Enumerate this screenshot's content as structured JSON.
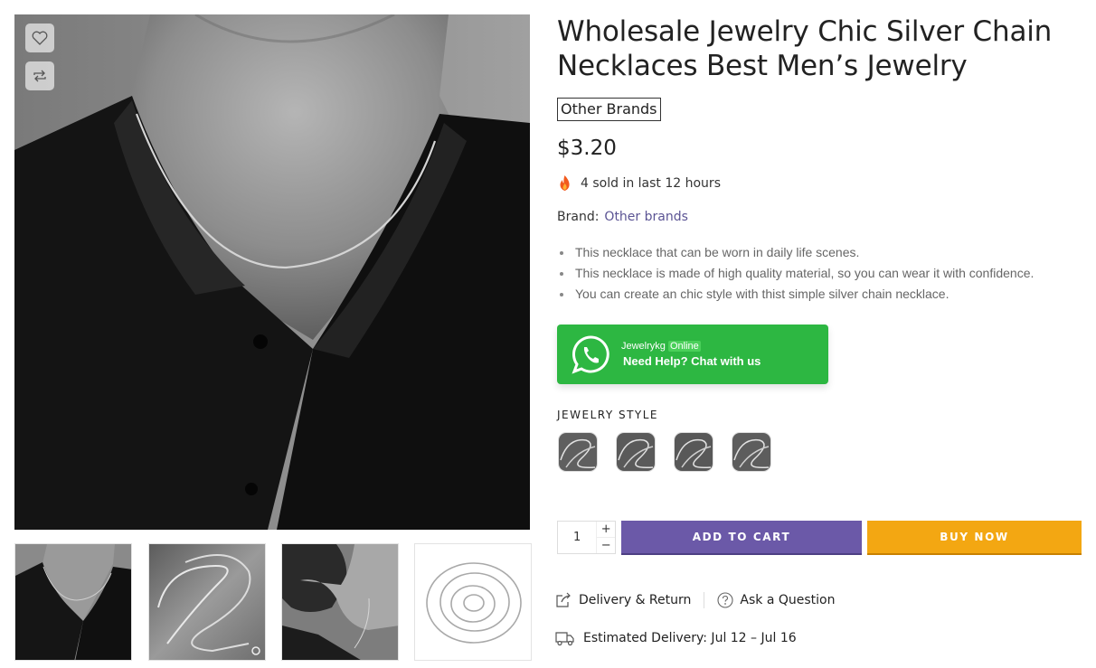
{
  "product": {
    "title": "Wholesale Jewelry Chic Silver Chain Necklaces Best Men’s Jewelry",
    "brand_badge": "Other Brands",
    "price": "$3.20",
    "sold_text": "4 sold in last 12 hours",
    "brand_label": "Brand:",
    "brand_link": "Other brands",
    "bullets": [
      "This necklace that can be worn in daily life scenes.",
      "This necklace is made of high quality material, so you can wear it with confidence.",
      "You can create an chic style with thist simple silver chain necklace."
    ]
  },
  "whatsapp": {
    "name": "Jewelrykg",
    "status": "Online",
    "cta": "Need Help? Chat with us",
    "color": "#2db742"
  },
  "options": {
    "label": "JEWELRY STYLE",
    "swatch_count": 4
  },
  "cart": {
    "quantity": "1",
    "plus": "+",
    "minus": "−",
    "add_to_cart": "ADD TO CART",
    "buy_now": "BUY NOW",
    "add_color": "#6b59a8",
    "buy_color": "#f3a712"
  },
  "links": {
    "delivery_return": "Delivery & Return",
    "ask_question": "Ask a Question",
    "estimated_delivery": "Estimated Delivery: Jul 12 – Jul 16"
  },
  "icons": {
    "wishlist": "heart-icon",
    "compare": "compare-arrows-icon",
    "fire": "fire-icon",
    "whatsapp": "whatsapp-icon",
    "delivery": "share-box-icon",
    "question": "question-circle-icon",
    "truck": "truck-icon"
  }
}
